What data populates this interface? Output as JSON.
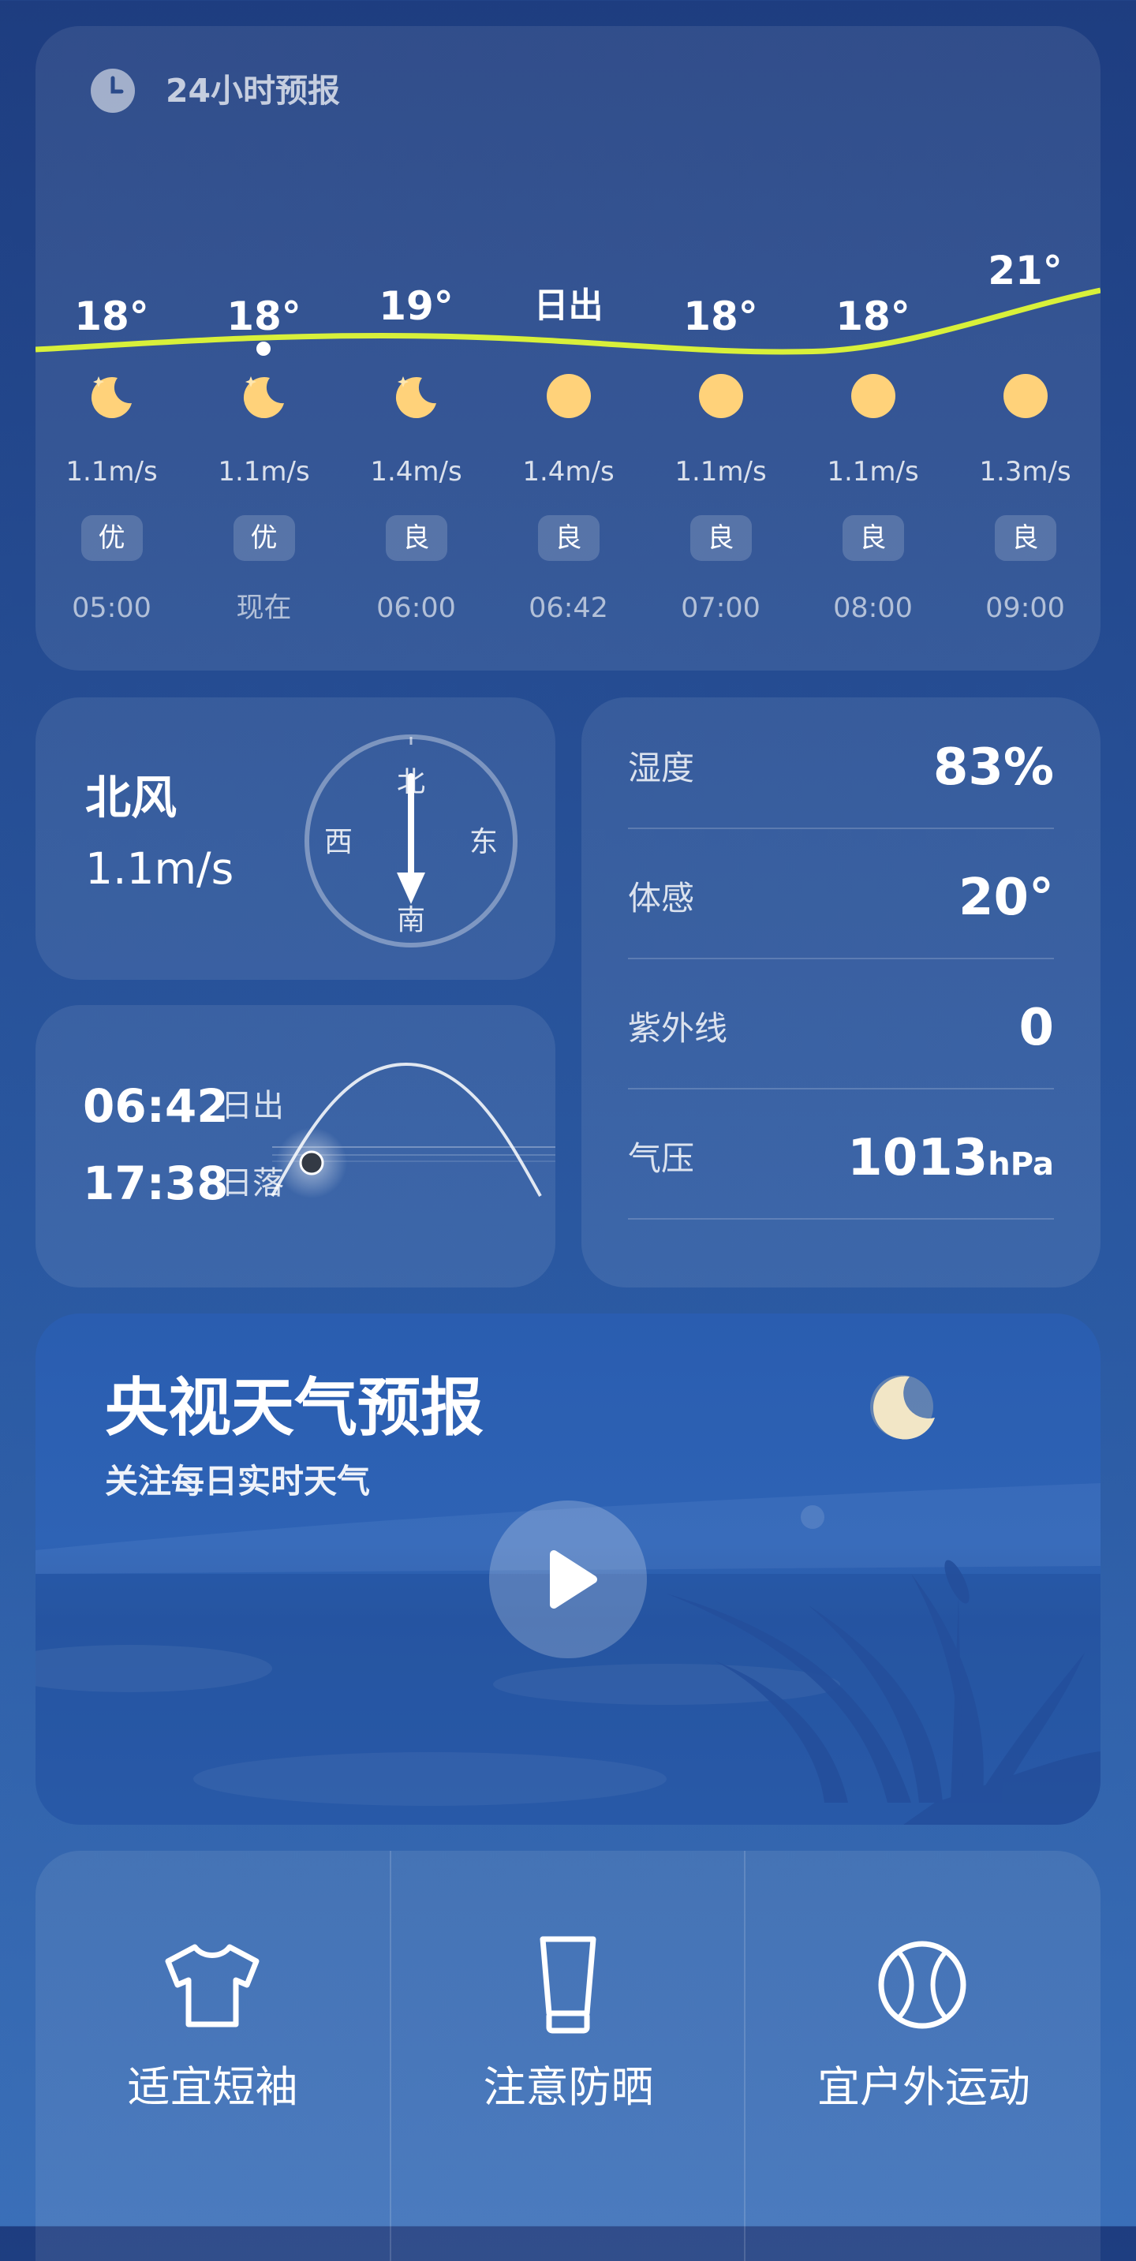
{
  "hourly": {
    "title": "24小时预报",
    "hours": [
      {
        "temp": "18°",
        "icon": "moon-stars-icon",
        "wind": "1.1m/s",
        "aqi": "优",
        "time": "05:00"
      },
      {
        "temp": "18°",
        "icon": "moon-stars-icon",
        "wind": "1.1m/s",
        "aqi": "优",
        "time": "现在"
      },
      {
        "temp": "19°",
        "icon": "moon-stars-icon",
        "wind": "1.4m/s",
        "aqi": "良",
        "time": "06:00"
      },
      {
        "temp": "日出",
        "icon": "sun-icon",
        "wind": "1.4m/s",
        "aqi": "良",
        "time": "06:42"
      },
      {
        "temp": "18°",
        "icon": "sun-icon",
        "wind": "1.1m/s",
        "aqi": "良",
        "time": "07:00"
      },
      {
        "temp": "18°",
        "icon": "sun-icon",
        "wind": "1.1m/s",
        "aqi": "良",
        "time": "08:00"
      },
      {
        "temp": "21°",
        "icon": "sun-icon",
        "wind": "1.3m/s",
        "aqi": "良",
        "time": "09:00"
      }
    ],
    "colors": {
      "curve": "#d8f03a",
      "sun": "#ffd27a"
    }
  },
  "wind": {
    "direction": "北风",
    "speed": "1.1m/s",
    "compass": {
      "north": "北",
      "south": "南",
      "east": "东",
      "west": "西"
    }
  },
  "sun": {
    "sunrise_time": "06:42",
    "sunrise_label": "日出",
    "sunset_time": "17:38",
    "sunset_label": "日落"
  },
  "details": [
    {
      "label": "湿度",
      "value": "83%",
      "unit": ""
    },
    {
      "label": "体感",
      "value": "20°",
      "unit": ""
    },
    {
      "label": "紫外线",
      "value": "0",
      "unit": ""
    },
    {
      "label": "气压",
      "value": "1013",
      "unit": "hPa"
    }
  ],
  "video": {
    "title": "央视天气预报",
    "subtitle": "关注每日实时天气",
    "play_icon": "play-icon"
  },
  "tips": [
    {
      "icon": "tshirt-icon",
      "label": "适宜短袖"
    },
    {
      "icon": "sunscreen-icon",
      "label": "注意防晒"
    },
    {
      "icon": "ball-icon",
      "label": "宜户外运动"
    }
  ]
}
